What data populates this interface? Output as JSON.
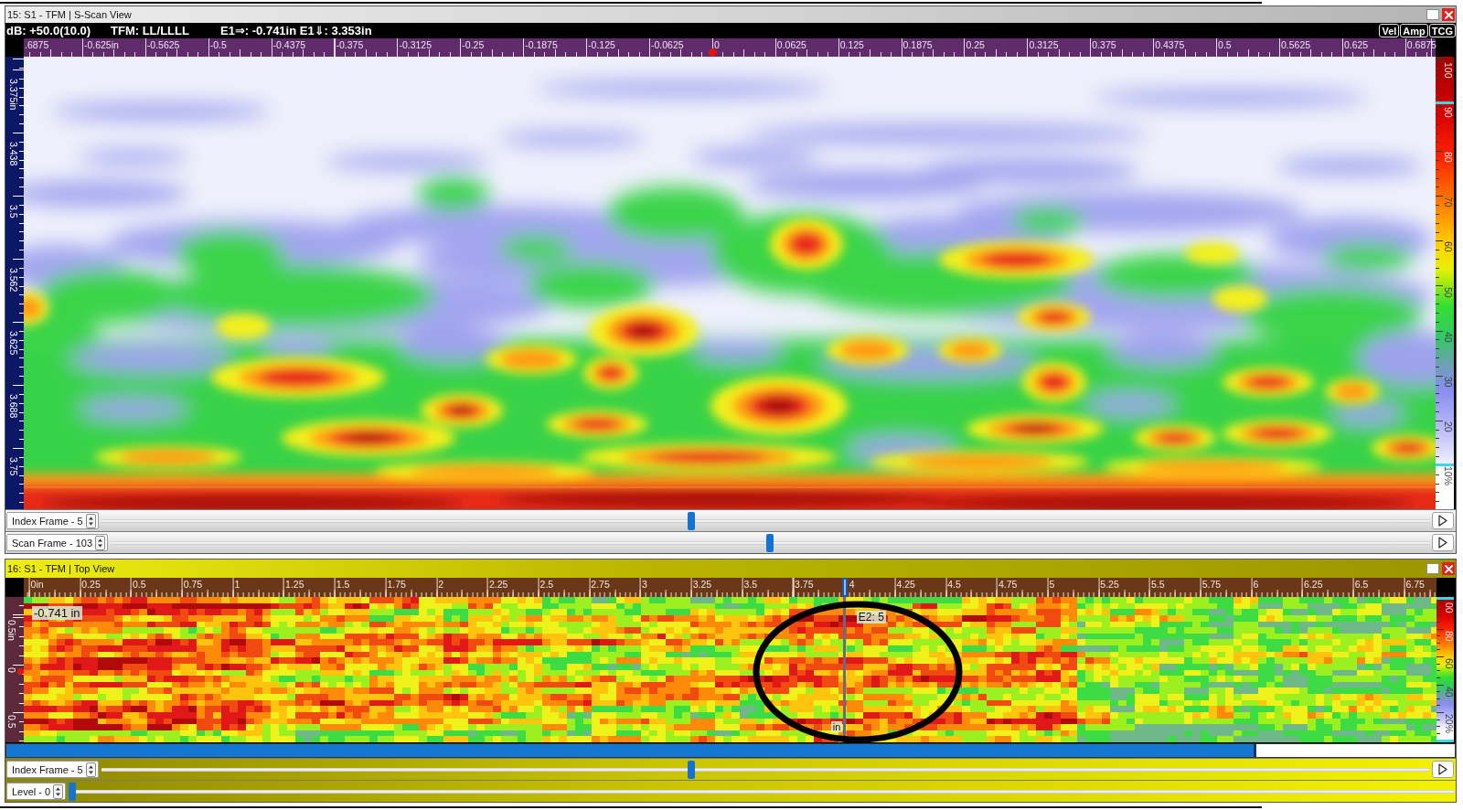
{
  "windows": [
    {
      "kind": "s_scan",
      "title": "15: S1 - TFM | S-Scan View",
      "readouts": [
        "dB: +50.0(10.0)",
        "TFM: LL/LLLL",
        "E1⇒: -0.741in E1⇓: 3.353in"
      ],
      "mode_buttons": [
        "Vel",
        "Amp",
        "TCG"
      ],
      "x_axis": [
        {
          "label": ".6875",
          "marked": false
        },
        {
          "label": "-0.625in",
          "marked": false
        },
        {
          "label": "-0.5625",
          "marked": false
        },
        {
          "label": "-0.5",
          "marked": false
        },
        {
          "label": "-0.4375",
          "marked": false
        },
        {
          "label": "-0.375",
          "marked": false
        },
        {
          "label": "-0.3125",
          "marked": false
        },
        {
          "label": "-0.25",
          "marked": false
        },
        {
          "label": "-0.1875",
          "marked": false
        },
        {
          "label": "-0.125",
          "marked": false
        },
        {
          "label": "-0.0625",
          "marked": false
        },
        {
          "label": "0",
          "marked": true
        },
        {
          "label": "0.0625",
          "marked": false
        },
        {
          "label": "0.125",
          "marked": false
        },
        {
          "label": "0.1875",
          "marked": false
        },
        {
          "label": "0.25",
          "marked": false
        },
        {
          "label": "0.3125",
          "marked": false
        },
        {
          "label": "0.375",
          "marked": false
        },
        {
          "label": "0.4375",
          "marked": false
        },
        {
          "label": "0.5",
          "marked": false
        },
        {
          "label": "0.5625",
          "marked": false
        },
        {
          "label": "0.625",
          "marked": false
        },
        {
          "label": "0.6875",
          "marked": false
        }
      ],
      "y_axis": [
        "3.375in",
        "3.438",
        "3.5",
        "3.562",
        "3.625",
        "3.688",
        "3.75"
      ],
      "color_scale": {
        "labels": [
          "100",
          "90",
          "80",
          "70",
          "60",
          "50",
          "40",
          "30",
          "20",
          "10%"
        ],
        "markers": [
          {
            "level": 0.9
          },
          {
            "level": 0.1
          }
        ]
      },
      "controls": [
        {
          "label": "Index Frame - 5",
          "level": 0.444,
          "play_button": true
        },
        {
          "label": "Scan Frame - 103",
          "level": 0.5,
          "play_button": true
        }
      ]
    },
    {
      "kind": "top_view",
      "title": "16: S1 - TFM | Top View",
      "x_axis": [
        {
          "label": "0in",
          "marked": false
        },
        {
          "label": "0.25",
          "marked": false
        },
        {
          "label": "0.5",
          "marked": false
        },
        {
          "label": "0.75",
          "marked": false
        },
        {
          "label": "1",
          "marked": false
        },
        {
          "label": "1.25",
          "marked": false
        },
        {
          "label": "1.5",
          "marked": false
        },
        {
          "label": "1.75",
          "marked": false
        },
        {
          "label": "2",
          "marked": false
        },
        {
          "label": "2.25",
          "marked": false
        },
        {
          "label": "2.5",
          "marked": false
        },
        {
          "label": "2.75",
          "marked": false
        },
        {
          "label": "3",
          "marked": false
        },
        {
          "label": "3.25",
          "marked": false
        },
        {
          "label": "3.5",
          "marked": false
        },
        {
          "label": "3.75",
          "marked": false
        },
        {
          "label": "4",
          "marked": true
        },
        {
          "label": "4.25",
          "marked": false
        },
        {
          "label": "4.5",
          "marked": false
        },
        {
          "label": "4.75",
          "marked": false
        },
        {
          "label": "5",
          "marked": false
        },
        {
          "label": "5.25",
          "marked": false
        },
        {
          "label": "5.5",
          "marked": false
        },
        {
          "label": "5.75",
          "marked": false
        },
        {
          "label": "6",
          "marked": false
        },
        {
          "label": "6.25",
          "marked": false
        },
        {
          "label": "6.5",
          "marked": false
        },
        {
          "label": "6.75",
          "marked": false
        }
      ],
      "y_axis": [
        {
          "label": "0.5in",
          "marked": false
        },
        {
          "label": "0",
          "marked": true
        },
        {
          "label": "0.5",
          "marked": false
        }
      ],
      "color_scale": {
        "labels": [
          "00",
          "80",
          "60",
          "40",
          "20%"
        ],
        "markers": [
          {
            "level": 1
          },
          {
            "level": 0
          }
        ]
      },
      "cursor_tags": [
        {
          "kind": "index",
          "text": "-0.741 in"
        },
        {
          "kind": "peak",
          "text": "E2: 5"
        },
        {
          "kind": "scan",
          "text": "in"
        }
      ],
      "progress": {
        "level": 0.863
      },
      "controls": [
        {
          "label": "Index Frame - 5",
          "level": 0.444,
          "play_button": true
        },
        {
          "label": "Level - 0",
          "level": 0,
          "play_button": false
        }
      ]
    }
  ]
}
